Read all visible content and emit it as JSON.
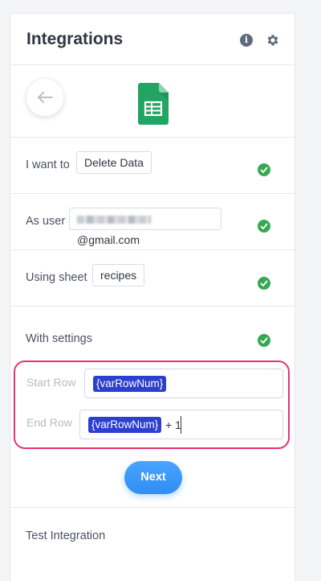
{
  "header": {
    "title": "Integrations",
    "info_glyph": "i"
  },
  "icons": {
    "info": "info-icon",
    "settings": "gear-icon",
    "back": "arrow-left-icon",
    "app": "google-sheets-icon",
    "status": "check-circle-icon"
  },
  "colors": {
    "accent": "#2f8ef5",
    "success": "#36a852",
    "highlight_border": "#e8336d",
    "variable_chip": "#2d3fcf"
  },
  "steps": [
    {
      "label": "I want to",
      "value": "Delete Data",
      "status": "complete"
    },
    {
      "label": "As user",
      "value": "@gmail.com",
      "status": "complete"
    },
    {
      "label": "Using sheet",
      "value": "recipes",
      "status": "complete"
    },
    {
      "label": "With settings",
      "status": "complete"
    }
  ],
  "settings": {
    "start_row": {
      "label": "Start Row",
      "variable": "{varRowNum}"
    },
    "end_row": {
      "label": "End Row",
      "variable": "{varRowNum}",
      "suffix": "+ 1"
    }
  },
  "next_button": {
    "label": "Next"
  },
  "footer": {
    "label": "Test Integration"
  }
}
